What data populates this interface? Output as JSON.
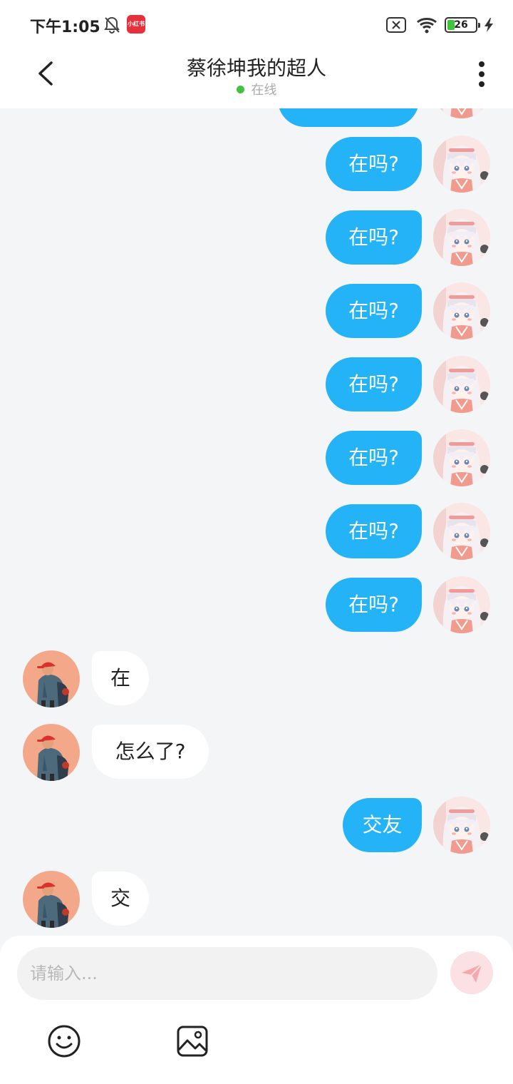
{
  "status_bar": {
    "time": "下午1:05",
    "app_badge": "小红书",
    "battery": "26",
    "icons": [
      "bell-off-icon",
      "app-badge-icon",
      "sim-x-icon",
      "wifi-icon",
      "battery-icon",
      "charging-bolt-icon"
    ]
  },
  "header": {
    "title": "蔡徐坤我的超人",
    "status": "在线",
    "status_color": "#3ec43e",
    "icons": [
      "back-arrow-icon",
      "more-vertical-icon"
    ]
  },
  "messages": [
    {
      "sender": "me",
      "text": ""
    },
    {
      "sender": "me",
      "text": "在吗?"
    },
    {
      "sender": "me",
      "text": "在吗?"
    },
    {
      "sender": "me",
      "text": "在吗?"
    },
    {
      "sender": "me",
      "text": "在吗?"
    },
    {
      "sender": "me",
      "text": "在吗?"
    },
    {
      "sender": "me",
      "text": "在吗?"
    },
    {
      "sender": "me",
      "text": "在吗?"
    },
    {
      "sender": "them",
      "text": "在"
    },
    {
      "sender": "them",
      "text": "怎么了?"
    },
    {
      "sender": "me",
      "text": "交友"
    },
    {
      "sender": "them",
      "text": "交"
    }
  ],
  "input": {
    "placeholder": "请输入...",
    "value": ""
  },
  "toolbar": {
    "icons": [
      "send-icon",
      "emoji-icon",
      "image-icon"
    ]
  },
  "colors": {
    "my_bubble": "#25b3f8",
    "their_bubble": "#ffffff",
    "background": "#f4f5f7",
    "send_button": "#fbe1e3"
  }
}
